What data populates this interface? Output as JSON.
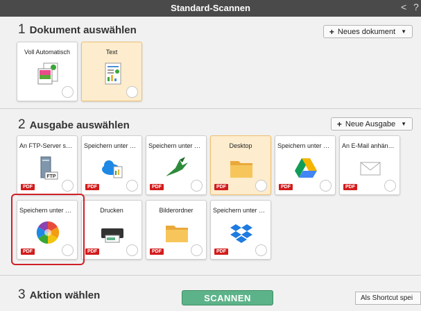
{
  "window": {
    "title": "Standard-Scannen",
    "back_glyph": "<",
    "help_glyph": "?"
  },
  "section1": {
    "number": "1",
    "title": "Dokument auswählen",
    "add_button": "Neues dokument",
    "tiles": [
      {
        "label": "Voll Automatisch",
        "icon": "photo-document-icon",
        "selected": false
      },
      {
        "label": "Text",
        "icon": "text-document-icon",
        "selected": true
      }
    ]
  },
  "section2": {
    "number": "2",
    "title": "Ausgabe auswählen",
    "add_button": "Neue Ausgabe",
    "pdf_badge": "PDF",
    "tiles": [
      {
        "label": "An FTP-Server sen...",
        "icon": "ftp-server-icon",
        "selected": false
      },
      {
        "label": "Speichern unter O...",
        "icon": "onedrive-icon",
        "selected": false
      },
      {
        "label": "Speichern unter Su...",
        "icon": "hummingbird-icon",
        "selected": false
      },
      {
        "label": "Desktop",
        "icon": "desktop-folder-icon",
        "selected": true
      },
      {
        "label": "Speichern unter G...",
        "icon": "google-drive-icon",
        "selected": false
      },
      {
        "label": "An E-Mail anhängen",
        "icon": "email-icon",
        "selected": false
      },
      {
        "label": "Speichern unter Mi...",
        "icon": "color-wheel-icon",
        "selected": false
      },
      {
        "label": "Drucken",
        "icon": "printer-icon",
        "selected": false
      },
      {
        "label": "Bilderordner",
        "icon": "pictures-folder-icon",
        "selected": false
      },
      {
        "label": "Speichern unter Dr...",
        "icon": "dropbox-icon",
        "selected": false
      }
    ]
  },
  "section3": {
    "number": "3",
    "title": "Aktion wählen",
    "scan_button": "SCANNEN",
    "shortcut_button": "Als Shortcut spei"
  },
  "colors": {
    "titlebar": "#4a4a4a",
    "selected_tile": "#fdeccd",
    "scan_button": "#5db389",
    "pdf_badge": "#d21b1b",
    "highlight": "#d01f26"
  }
}
